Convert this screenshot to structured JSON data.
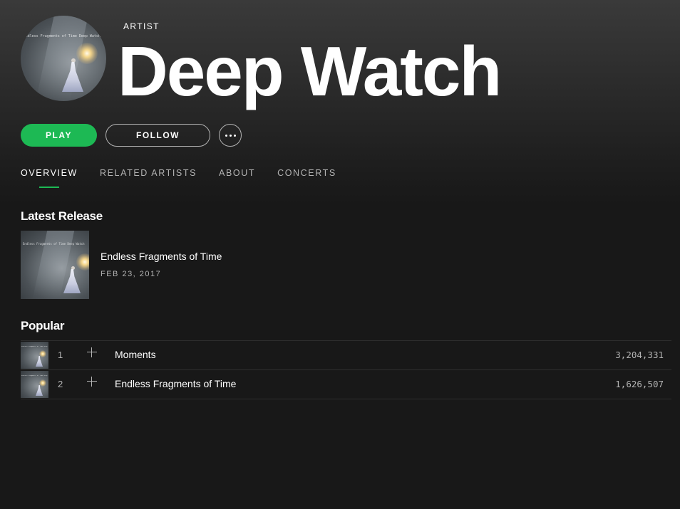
{
  "artist": {
    "kicker": "ARTIST",
    "name": "Deep Watch",
    "artwork_caption": "Endless Fragments of Time   Deep Watch"
  },
  "actions": {
    "play_label": "PLAY",
    "follow_label": "FOLLOW",
    "more_icon": "ellipsis-icon"
  },
  "tabs": [
    {
      "label": "OVERVIEW",
      "active": true
    },
    {
      "label": "RELATED ARTISTS",
      "active": false
    },
    {
      "label": "ABOUT",
      "active": false
    },
    {
      "label": "CONCERTS",
      "active": false
    }
  ],
  "latest_release": {
    "heading": "Latest Release",
    "title": "Endless Fragments of Time",
    "date": "FEB 23, 2017"
  },
  "popular": {
    "heading": "Popular",
    "tracks": [
      {
        "number": "1",
        "title": "Moments",
        "plays": "3,204,331"
      },
      {
        "number": "2",
        "title": "Endless Fragments of Time",
        "plays": "1,626,507"
      }
    ]
  },
  "colors": {
    "accent": "#1db954",
    "background": "#181818",
    "muted_text": "#b3b3b3"
  }
}
